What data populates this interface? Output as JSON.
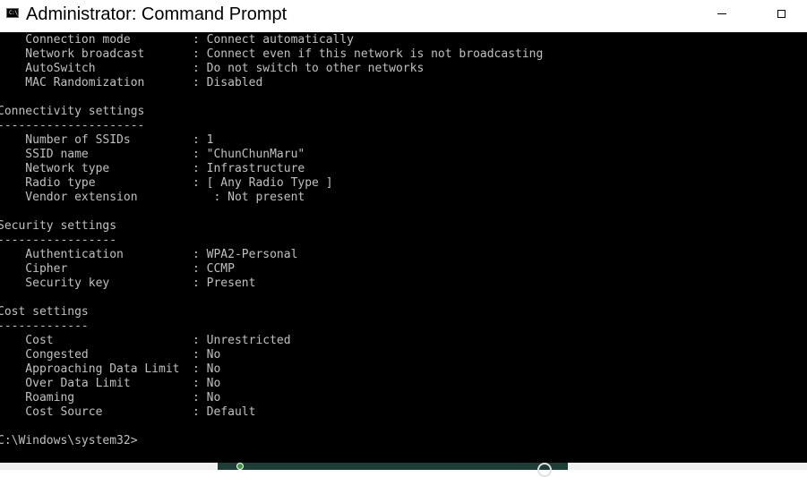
{
  "window": {
    "title": "Administrator: Command Prompt",
    "icon": "cmd-icon",
    "icon_glyph": "C:\\_",
    "minimize_glyph": "minimize-icon",
    "maximize_glyph": "maximize-icon"
  },
  "console": {
    "lines": [
      {
        "label": "    Connection mode",
        "value": ": Connect automatically"
      },
      {
        "label": "    Network broadcast",
        "value": ": Connect even if this network is not broadcasting"
      },
      {
        "label": "    AutoSwitch",
        "value": ": Do not switch to other networks"
      },
      {
        "label": "    MAC Randomization",
        "value": ": Disabled"
      },
      {
        "label": "",
        "value": ""
      },
      {
        "label": "Connectivity settings",
        "value": ""
      },
      {
        "label": "---------------------",
        "value": ""
      },
      {
        "label": "    Number of SSIDs",
        "value": ": 1"
      },
      {
        "label": "    SSID name",
        "value": ": \"ChunChunMaru\""
      },
      {
        "label": "    Network type",
        "value": ": Infrastructure"
      },
      {
        "label": "    Radio type",
        "value": ": [ Any Radio Type ]"
      },
      {
        "label": "    Vendor extension",
        "value": "   : Not present"
      },
      {
        "label": "",
        "value": ""
      },
      {
        "label": "Security settings",
        "value": ""
      },
      {
        "label": "-----------------",
        "value": ""
      },
      {
        "label": "    Authentication",
        "value": ": WPA2-Personal"
      },
      {
        "label": "    Cipher",
        "value": ": CCMP"
      },
      {
        "label": "    Security key",
        "value": ": Present"
      },
      {
        "label": "",
        "value": ""
      },
      {
        "label": "Cost settings",
        "value": ""
      },
      {
        "label": "-------------",
        "value": ""
      },
      {
        "label": "    Cost",
        "value": ": Unrestricted"
      },
      {
        "label": "    Congested",
        "value": ": No"
      },
      {
        "label": "    Approaching Data Limit",
        "value": ": No"
      },
      {
        "label": "    Over Data Limit",
        "value": ": No"
      },
      {
        "label": "    Roaming",
        "value": ": No"
      },
      {
        "label": "    Cost Source",
        "value": ": Default"
      },
      {
        "label": "",
        "value": ""
      },
      {
        "label": "C:\\Windows\\system32>",
        "value": ""
      }
    ]
  },
  "colors": {
    "console_bg": "#000000",
    "console_fg": "#c0c0c0",
    "titlebar_bg": "#ffffff"
  }
}
